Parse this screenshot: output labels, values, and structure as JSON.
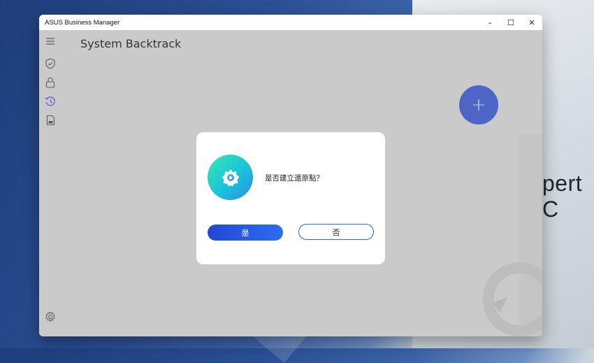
{
  "background": {
    "text": "pert C"
  },
  "window": {
    "title": "ASUS Business Manager",
    "controls": {
      "minimize": "–",
      "maximize": "☐",
      "close": "✕"
    }
  },
  "sidebar": {
    "items": [
      {
        "icon": "hamburger-menu-icon"
      },
      {
        "icon": "shield-check-icon"
      },
      {
        "icon": "lock-icon"
      },
      {
        "icon": "history-icon"
      },
      {
        "icon": "document-icon"
      },
      {
        "icon": "gear-icon"
      }
    ]
  },
  "main": {
    "page_title": "System Backtrack",
    "fab_label": "+",
    "accent_color": "#3f63f0"
  },
  "dialog": {
    "message": "是否建立還原點？",
    "yes_label": "是",
    "no_label": "否",
    "icon": "settings-gear-icon"
  }
}
